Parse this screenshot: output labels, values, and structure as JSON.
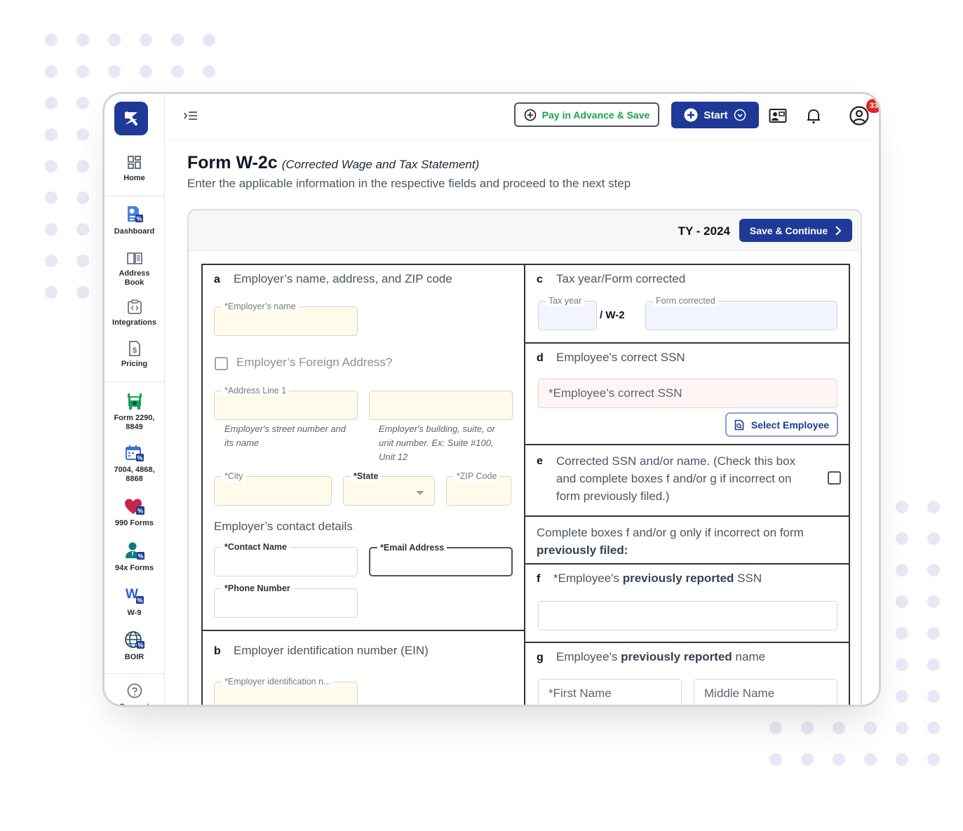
{
  "sidebar": {
    "logo": "TaxBandits logo",
    "items": [
      {
        "label": "Home",
        "icon": "home-grid-icon"
      },
      {
        "label": "Dashboard",
        "icon": "dashboard-icon"
      },
      {
        "label": "Address Book",
        "icon": "address-book-icon"
      },
      {
        "label": "Integrations",
        "icon": "integrations-icon"
      },
      {
        "label": "Pricing",
        "icon": "pricing-icon"
      },
      {
        "label": "Form 2290, 8849",
        "icon": "truck-icon"
      },
      {
        "label": "7004, 4868, 8868",
        "icon": "calendar-icon"
      },
      {
        "label": "990 Forms",
        "icon": "heart-icon"
      },
      {
        "label": "94x Forms",
        "icon": "person-icon"
      },
      {
        "label": "W-9",
        "icon": "w9-icon"
      },
      {
        "label": "BOIR",
        "icon": "globe-icon"
      },
      {
        "label": "Support",
        "icon": "help-icon"
      }
    ]
  },
  "topbar": {
    "pay_advance_label": "Pay in Advance & Save",
    "start_label": "Start",
    "notification_count": "33",
    "colors": {
      "brand": "#1e3a96",
      "pay_text": "#16a34a",
      "badge": "#dc2626"
    }
  },
  "page": {
    "title": "Form W-2c",
    "title_sub": "(Corrected Wage and Tax Statement)",
    "subtitle": "Enter the applicable information in the respective fields and proceed to the next step"
  },
  "card": {
    "tax_year": "TY - 2024",
    "save_continue_label": "Save & Continue"
  },
  "sections": {
    "a": {
      "letter": "a",
      "title": "Employer’s name, address, and ZIP code",
      "employer_name_label": "*Employer’s name",
      "foreign_address_label": "Employer’s Foreign Address?",
      "address1_label": "*Address Line 1",
      "address1_hint": "Employer's street number and its name",
      "address2_hint": "Employer's building, suite, or unit number. Ex: Suite #100, Unit 12",
      "city_label": "*City",
      "state_label": "*State",
      "zip_label": "*ZIP Code",
      "contact_title": "Employer’s contact details",
      "contact_name_label": "*Contact Name",
      "email_label": "*Email Address",
      "phone_label": "*Phone Number"
    },
    "b": {
      "letter": "b",
      "title": "Employer identification number (EIN)",
      "ein_label": "*Employer identification n..."
    },
    "c": {
      "letter": "c",
      "title": "Tax year/Form corrected",
      "tax_year_label": "Tax year",
      "separator": "/ W-2",
      "form_corrected_label": "Form corrected"
    },
    "d": {
      "letter": "d",
      "title": "Employee's correct SSN",
      "ssn_placeholder": "*Employee’s correct SSN",
      "select_employee_label": "Select Employee"
    },
    "e": {
      "letter": "e",
      "title": "Corrected SSN and/or name. (Check this box and complete boxes f and/or g if incorrect on form previously filed.)"
    },
    "note": {
      "text": "Complete boxes f and/or g only if incorrect on form",
      "bold": "previously filed:"
    },
    "f": {
      "letter": "f",
      "prefix": "*Employee's",
      "bold": "previously reported",
      "suffix": "SSN"
    },
    "g": {
      "letter": "g",
      "prefix": "Employee's",
      "bold": "previously reported",
      "suffix": "name",
      "first_name_placeholder": "*First Name",
      "middle_name_placeholder": "Middle Name"
    }
  }
}
